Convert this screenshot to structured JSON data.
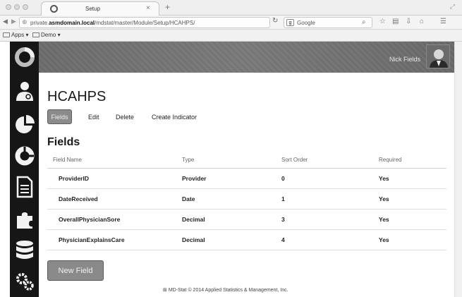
{
  "browser": {
    "tab_title": "Setup",
    "tab_close": "×",
    "new_tab": "+",
    "url_prefix": "private.",
    "url_domain": "asmdomain.local",
    "url_path": "/mdstat/master/Module/Setup/HCAHPS/",
    "search_engine": "Google",
    "bookmarks": [
      {
        "label": "Apps ▾"
      },
      {
        "label": "Demo ▾"
      }
    ]
  },
  "header": {
    "user_name": "Nick Fields"
  },
  "page": {
    "title": "HCAHPS",
    "actions": {
      "fields": "Fields",
      "edit": "Edit",
      "delete": "Delete",
      "create_indicator": "Create Indicator"
    },
    "section_title": "Fields",
    "new_field_label": "New Field",
    "footer": "MD-Stat © 2014 Applied Statistics & Management, Inc."
  },
  "table": {
    "columns": [
      "Field Name",
      "Type",
      "Sort Order",
      "Required"
    ],
    "rows": [
      [
        "ProviderID",
        "Provider",
        "0",
        "Yes"
      ],
      [
        "DateReceived",
        "Date",
        "1",
        "Yes"
      ],
      [
        "OverallPhysicianSore",
        "Decimal",
        "3",
        "Yes"
      ],
      [
        "PhysicianExplainsCare",
        "Decimal",
        "4",
        "Yes"
      ]
    ]
  },
  "colors": {
    "sidebar": "#161616",
    "header": "#737373",
    "button": "#8b8b8b"
  },
  "icons": {
    "sidebar": [
      "logo-ring-icon",
      "doctor-icon",
      "pie-chart-icon",
      "ring-chart-icon",
      "document-icon",
      "puzzle-icon",
      "database-icon",
      "gears-icon"
    ]
  }
}
